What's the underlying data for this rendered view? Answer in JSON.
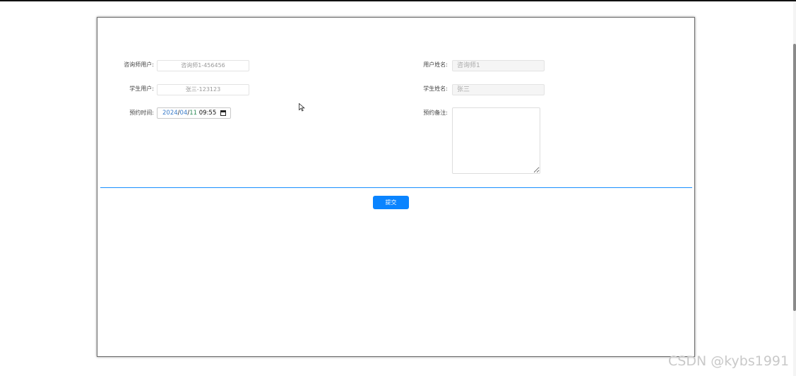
{
  "form": {
    "counselor_user_label": "咨询师用户:",
    "counselor_user_value": "咨询师1-456456",
    "user_name_label": "用户姓名:",
    "user_name_value": "咨询师1",
    "student_user_label": "学生用户:",
    "student_user_value": "张三-123123",
    "student_name_label": "学生姓名:",
    "student_name_value": "张三",
    "appointment_time_label": "预约时间:",
    "appointment_date": {
      "year": "2024",
      "sep1": "/",
      "month": "04",
      "sep2": "/",
      "day": "11",
      "time": "09:55"
    },
    "note_label": "预约备注:",
    "note_value": "",
    "submit_label": "提交"
  },
  "watermark": "CSDN @kybs1991",
  "colors": {
    "accent": "#1890ff",
    "button": "#0a84ff"
  }
}
